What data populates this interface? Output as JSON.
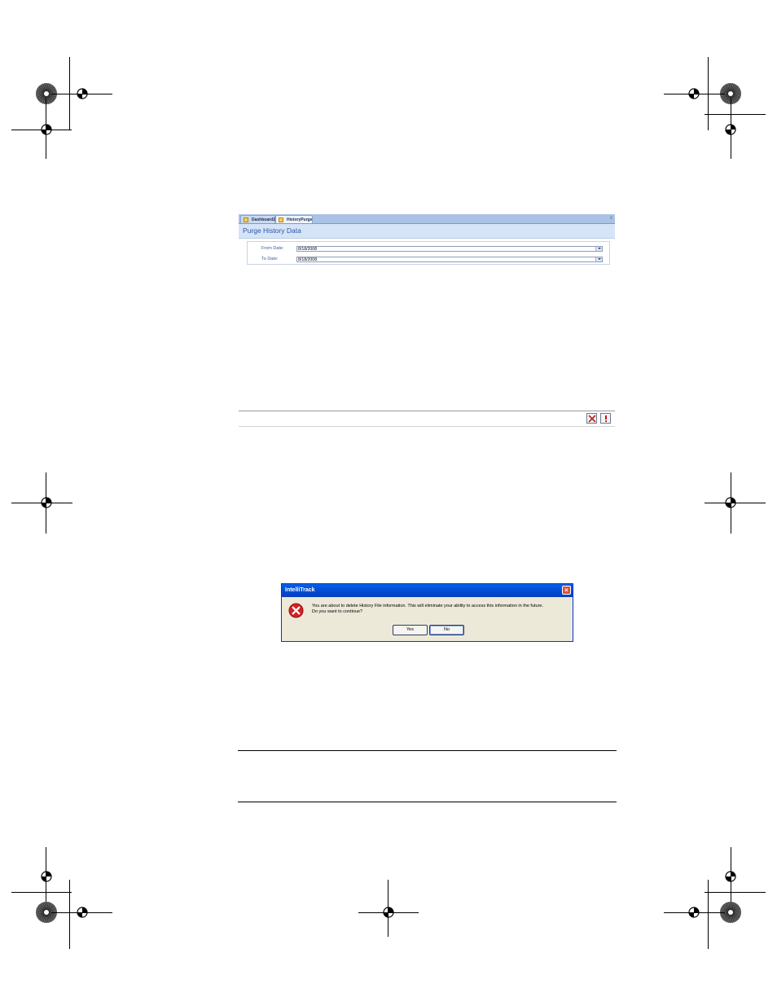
{
  "form": {
    "tabs": [
      {
        "label": "Dashboard2"
      },
      {
        "label": "HistoryPurge"
      }
    ],
    "close_glyph": "x",
    "title": "Purge History Data",
    "fields": [
      {
        "label": "From Date:",
        "value": "8/18/2008"
      },
      {
        "label": "To Date:",
        "value": "8/18/2008"
      }
    ]
  },
  "toolbar": {
    "buttons": [
      {
        "icon": "cancel-x-icon",
        "color": "#c0201a"
      },
      {
        "icon": "exclamation-run-icon",
        "color": "#d01010"
      }
    ]
  },
  "dialog": {
    "title": "IntelliTrack",
    "close_glyph": "×",
    "icon": "error-icon",
    "message_line1": "You are about to delete History File information.  This will eliminate your ability to access this information in the future.",
    "message_line2": "Do you want to continue?",
    "yes_label": "Yes",
    "no_label": "No"
  },
  "colors": {
    "accent_title": "#2a55a8",
    "dialog_titlebar": "#0049d4",
    "error_red": "#d42020"
  }
}
